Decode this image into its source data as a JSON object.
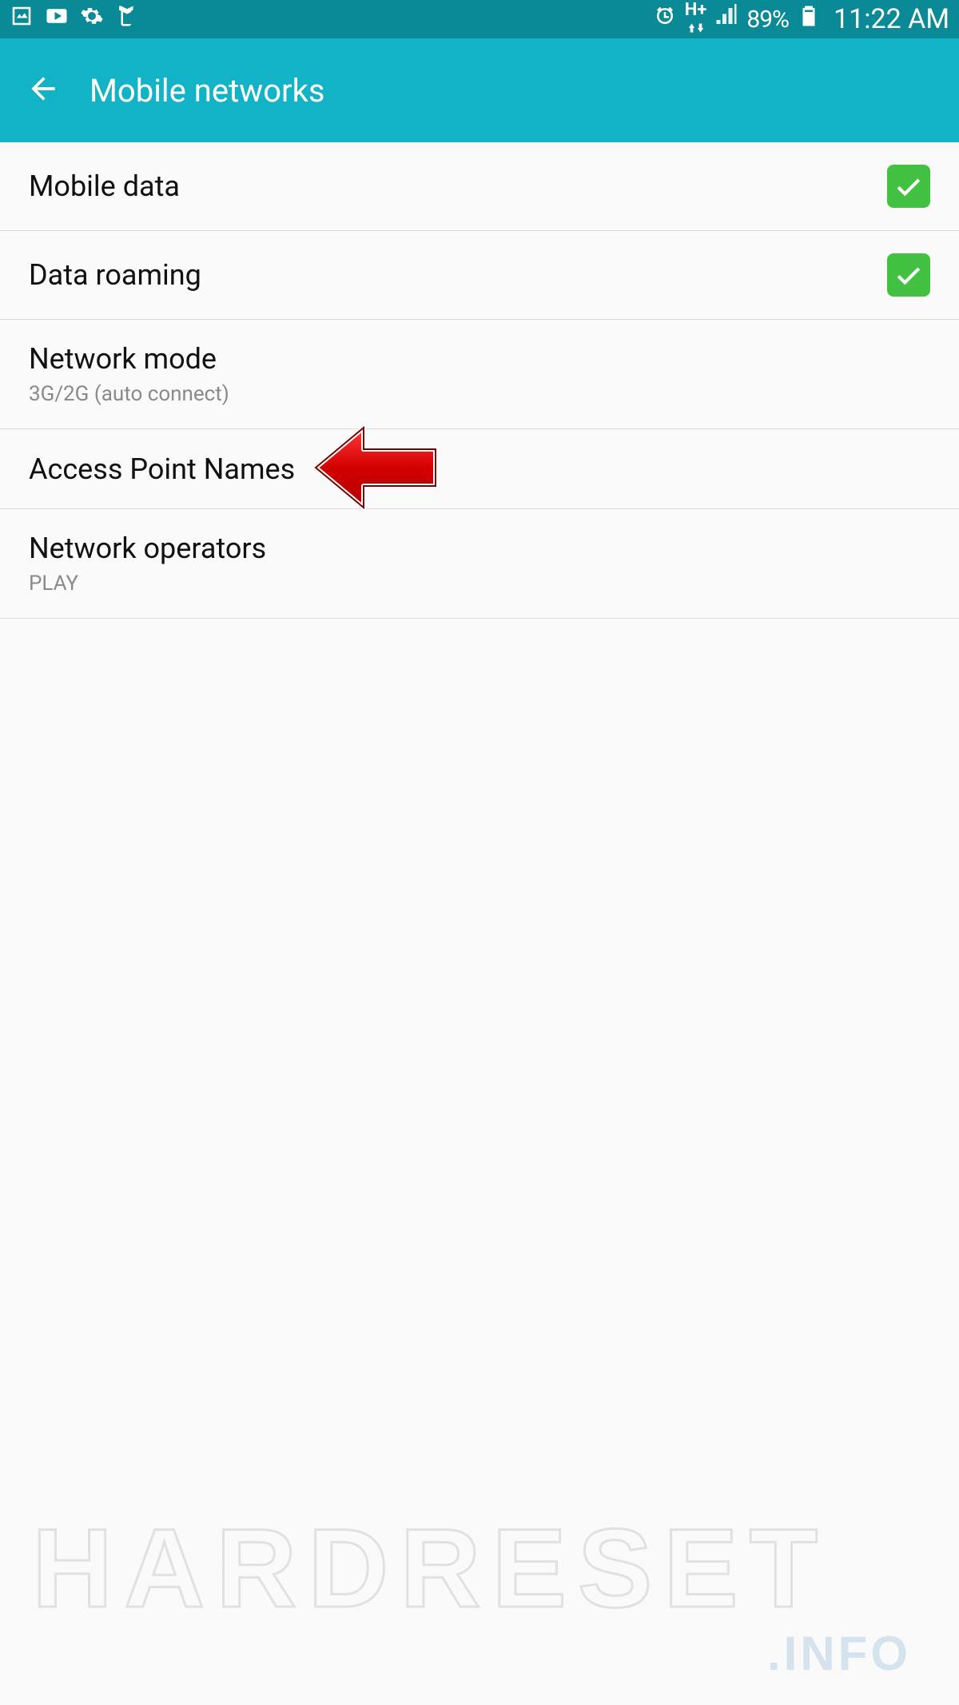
{
  "status_bar": {
    "battery_percent": "89%",
    "time": "11:22 AM",
    "network_type": "H+"
  },
  "app_bar": {
    "title": "Mobile networks"
  },
  "items": [
    {
      "label": "Mobile data",
      "checked": true
    },
    {
      "label": "Data roaming",
      "checked": true
    },
    {
      "label": "Network mode",
      "sub": "3G/2G (auto connect)"
    },
    {
      "label": "Access Point Names"
    },
    {
      "label": "Network operators",
      "sub": "PLAY"
    }
  ],
  "watermark": {
    "main": "HARDRESET",
    "sub": ".INFO"
  }
}
